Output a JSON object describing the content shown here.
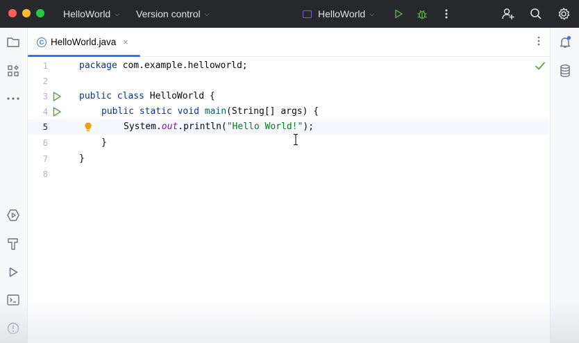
{
  "titlebar": {
    "project_name": "HelloWorld",
    "vcs_label": "Version control",
    "run_config": "HelloWorld"
  },
  "tabs": [
    {
      "label": "HelloWorld.java",
      "close": "×",
      "type_badge": "C"
    }
  ],
  "editor": {
    "line_numbers": [
      "1",
      "2",
      "3",
      "4",
      "5",
      "6",
      "7",
      "8"
    ],
    "current_line": "5",
    "lines": {
      "l1_kw": "package",
      "l1_rest": " com.example.helloworld;",
      "l3_kw1": "public",
      "l3_kw2": "class",
      "l3_name": " HelloWorld {",
      "l4_kw1": "public",
      "l4_kw2": "static",
      "l4_kw3": "void",
      "l4_fn": "main",
      "l4_rest": "(String[] args) {",
      "l5_a": "System.",
      "l5_out": "out",
      "l5_b": ".println(",
      "l5_str": "\"Hello World!\"",
      "l5_c": ");",
      "l6": "}",
      "l7": "}"
    }
  },
  "icons": {
    "left": [
      "folder-icon",
      "structure-icon",
      "more-icon",
      "services-icon",
      "build-icon",
      "run-icon",
      "terminal-icon",
      "problems-icon"
    ],
    "right": [
      "notifications-icon",
      "database-icon"
    ]
  },
  "colors": {
    "accent": "#3574f0",
    "run_green": "#499c54",
    "titlebar_bg": "#27282c"
  }
}
